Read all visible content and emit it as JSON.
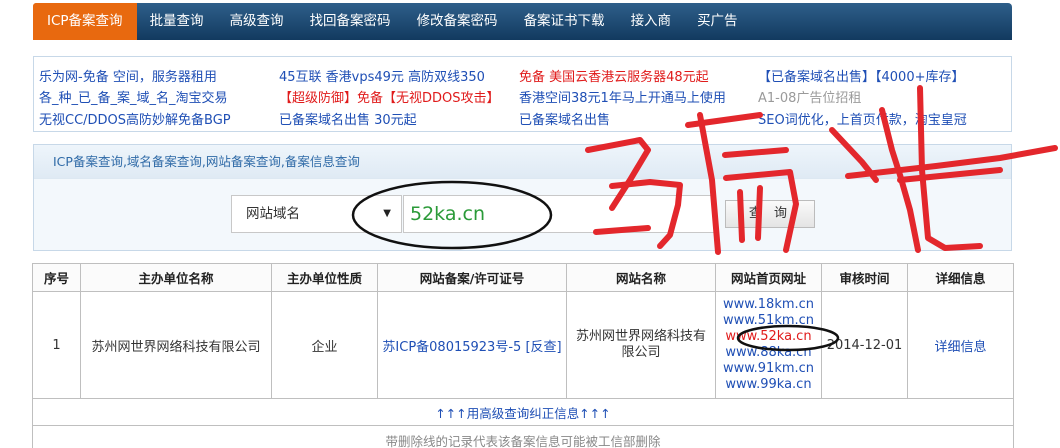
{
  "nav": {
    "items": [
      {
        "label": "ICP备案查询",
        "active": true
      },
      {
        "label": "批量查询"
      },
      {
        "label": "高级查询"
      },
      {
        "label": "找回备案密码"
      },
      {
        "label": "修改备案密码"
      },
      {
        "label": "备案证书下载"
      },
      {
        "label": "接入商"
      },
      {
        "label": "买广告"
      }
    ]
  },
  "ads": {
    "r1c1": "乐为网-免备 空间，服务器租用",
    "r1c2": "45互联 香港vps49元 高防双线350",
    "r1c3": "免备 美国云香港云服务器48元起",
    "r1c4": "【已备案域名出售】【4000+库存】",
    "r2c1": "各_种_已_备_案_域_名_淘宝交易",
    "r2c2": "【超级防御】免备【无视DDOS攻击】",
    "r2c3": "香港空间38元1年马上开通马上使用",
    "r2c4": "A1-08广告位招租",
    "r3c1": "无视CC/DDOS高防妙解免备BGP",
    "r3c2": "已备案域名出售 30元起",
    "r3c3": "已备案域名出售",
    "r3c4": "SEO词优化，上首页付款，淘宝皇冠"
  },
  "search": {
    "title": "ICP备案查询,域名备案查询,网站备案查询,备案信息查询",
    "select_value": "网站域名",
    "input_value": "52ka.cn",
    "button_label": "查 询"
  },
  "table": {
    "headers": [
      "序号",
      "主办单位名称",
      "主办单位性质",
      "网站备案/许可证号",
      "网站名称",
      "网站首页网址",
      "审核时间",
      "详细信息"
    ],
    "row": {
      "index": "1",
      "org": "苏州网世界网络科技有限公司",
      "nature": "企业",
      "license": "苏ICP备08015923号-5",
      "license_check": "[反查]",
      "site_name": "苏州网世界网络科技有限公司",
      "urls": [
        "www.18km.cn",
        "www.51km.cn",
        "www.52ka.cn",
        "www.88ka.cn",
        "www.91km.cn",
        "www.99ka.cn"
      ],
      "highlight_url_index": 2,
      "date": "2014-12-01",
      "detail": "详细信息"
    },
    "footer_link": "↑↑↑用高级查询纠正信息↑↑↑",
    "footer_note": "带删除线的记录代表该备案信息可能被工信部删除"
  },
  "handwriting": "骗子",
  "colors": {
    "nav": "#1d4a72",
    "nav_active": "#e8690f",
    "ink": "#e3272c",
    "link": "#1f4fb5"
  }
}
